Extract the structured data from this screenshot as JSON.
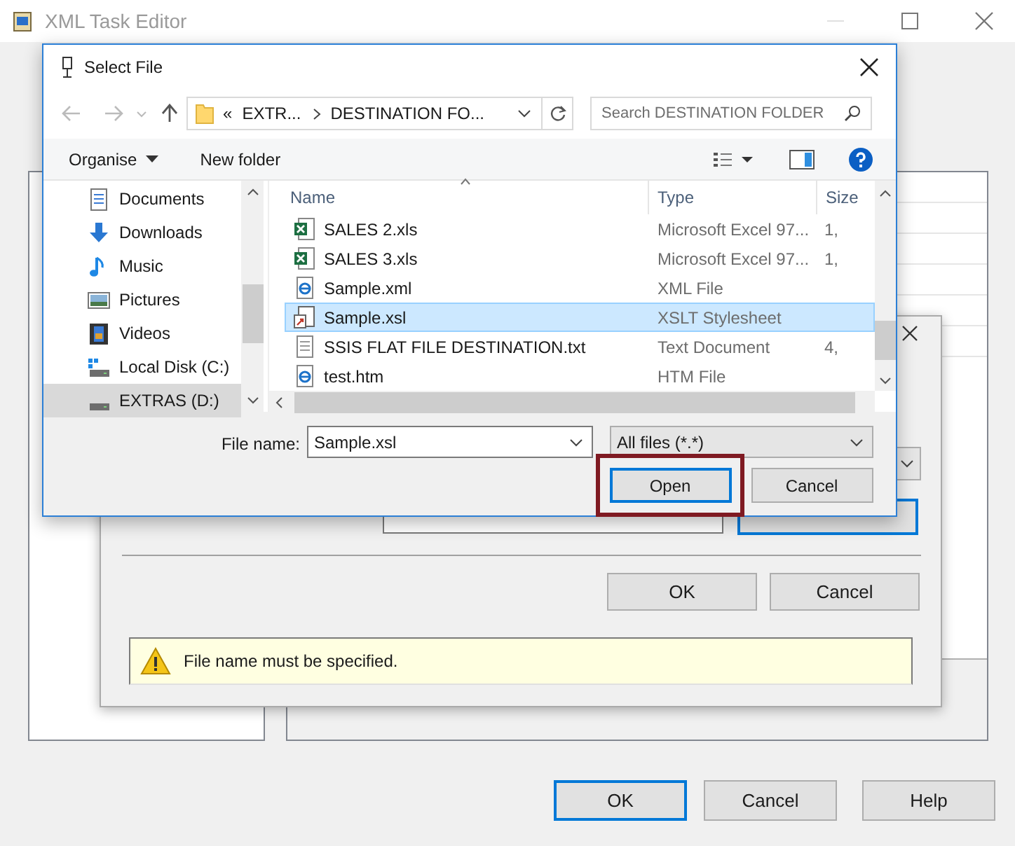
{
  "main_window": {
    "title": "XML Task Editor",
    "buttons": [
      {
        "label": "OK",
        "focused": true
      },
      {
        "label": "Cancel",
        "focused": false
      },
      {
        "label": "Help",
        "focused": false
      }
    ]
  },
  "input_dialog": {
    "buttons": [
      {
        "label": "OK"
      },
      {
        "label": "Cancel"
      }
    ],
    "message": "File name must be specified."
  },
  "file_dialog": {
    "title": "Select File",
    "breadcrumb_prefix": "«",
    "breadcrumb": [
      "EXTR...",
      "DESTINATION FO..."
    ],
    "search": {
      "placeholder": "Search DESTINATION FOLDER"
    },
    "toolbar": [
      {
        "label": "Organise",
        "dropdown": true
      },
      {
        "label": "New folder",
        "dropdown": false
      }
    ],
    "nav_items": [
      {
        "label": "Documents",
        "kind": "documents",
        "selected": false
      },
      {
        "label": "Downloads",
        "kind": "downloads",
        "selected": false
      },
      {
        "label": "Music",
        "kind": "music",
        "selected": false
      },
      {
        "label": "Pictures",
        "kind": "pictures",
        "selected": false
      },
      {
        "label": "Videos",
        "kind": "videos",
        "selected": false
      },
      {
        "label": "Local Disk (C:)",
        "kind": "system-disk",
        "selected": false
      },
      {
        "label": "EXTRAS (D:)",
        "kind": "disk",
        "selected": true
      }
    ],
    "columns": [
      "Name",
      "Type",
      "Size"
    ],
    "files": [
      {
        "name": "SALES 2.xls",
        "type": "Microsoft Excel 97...",
        "size": "1,",
        "kind": "excel",
        "selected": false
      },
      {
        "name": "SALES 3.xls",
        "type": "Microsoft Excel 97...",
        "size": "1,",
        "kind": "excel",
        "selected": false
      },
      {
        "name": "Sample.xml",
        "type": "XML File",
        "kind": "web",
        "selected": false
      },
      {
        "name": "Sample.xsl",
        "type": "XSLT Stylesheet",
        "kind": "stylesheet",
        "selected": true
      },
      {
        "name": "SSIS FLAT FILE DESTINATION.txt",
        "type": "Text Document",
        "size": "4,",
        "kind": "text",
        "selected": false
      },
      {
        "name": "test.htm",
        "type": "HTM File",
        "kind": "web",
        "selected": false
      }
    ],
    "file_name_label": "File name:",
    "file_name": "Sample.xsl",
    "filter": "All files (*.*)",
    "buttons": [
      {
        "label": "Open",
        "default": true,
        "highlighted": true
      },
      {
        "label": "Cancel",
        "default": false,
        "highlighted": false
      }
    ]
  }
}
